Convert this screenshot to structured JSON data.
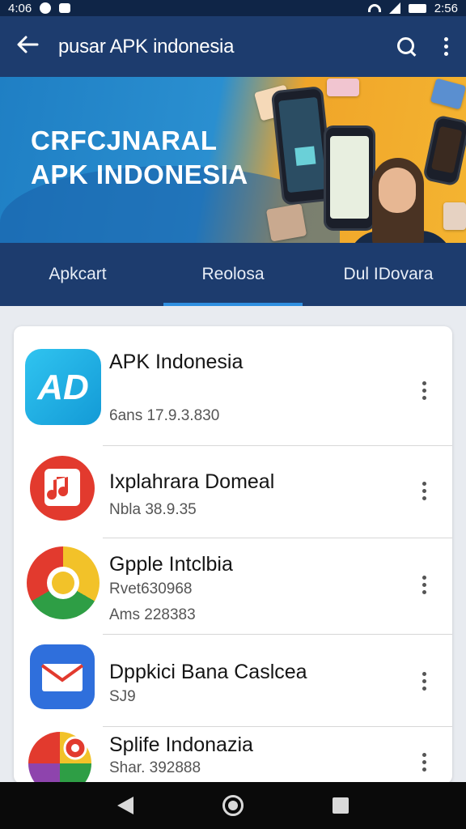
{
  "status_bar": {
    "time": "4:06",
    "clock_right": "2:56"
  },
  "app_bar": {
    "title": "pusar APK indonesia"
  },
  "banner": {
    "headline_line1": "CRFCJNARAL",
    "headline_line2": "APK INDONESIA"
  },
  "tabs": [
    {
      "label": "Apkcart",
      "active": false
    },
    {
      "label": "Reolosa",
      "active": true
    },
    {
      "label": "Dul IDovara",
      "active": false
    }
  ],
  "apps": [
    {
      "name": "APK Indonesia",
      "sub1": "6ans 17.9.3.830",
      "sub2": "",
      "icon": "ad-icon"
    },
    {
      "name": "Ixplahrara Domeal",
      "sub1": "Nbla 38.9.35",
      "sub2": "",
      "icon": "music-note-icon"
    },
    {
      "name": "Gpple Intclbia",
      "sub1": "Rvet630968",
      "sub2": "Ams 228383",
      "icon": "chrome-like-icon"
    },
    {
      "name": "Dppkici Bana Caslcea",
      "sub1": "SJ9",
      "sub2": "",
      "icon": "mail-envelope-icon"
    },
    {
      "name": "Splife Indonazia",
      "sub1": "Shar. 392888",
      "sub2": "",
      "icon": "maps-pin-icon"
    }
  ],
  "colors": {
    "appbar": "#1d3c6e",
    "tab_indicator": "#2f8fe0",
    "banner_blue": "#1f7fc4",
    "banner_orange": "#f0a529"
  }
}
